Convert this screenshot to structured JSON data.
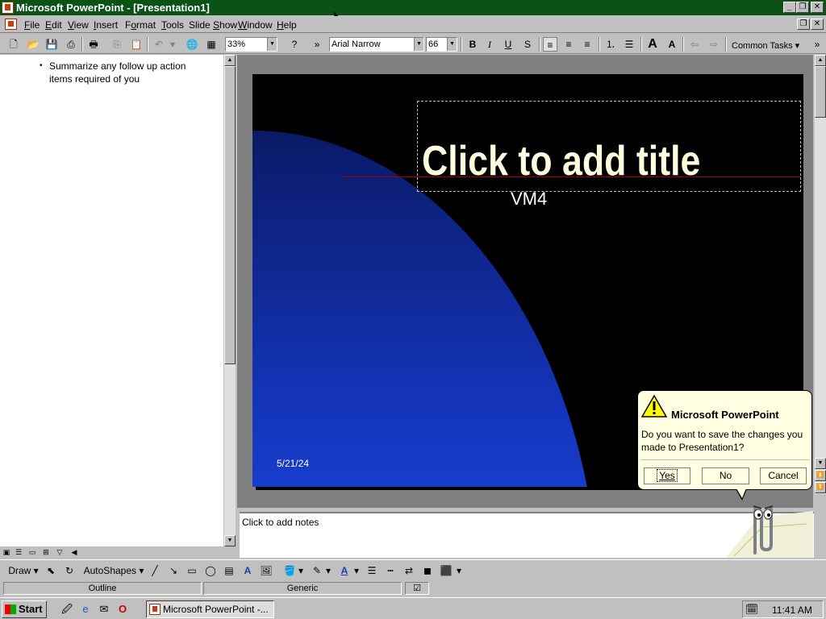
{
  "window": {
    "title": "Microsoft PowerPoint - [Presentation1]",
    "controls": [
      "_",
      "❐",
      "✕"
    ]
  },
  "menu": {
    "items": [
      {
        "pre": "",
        "ul": "F",
        "post": "ile"
      },
      {
        "pre": "",
        "ul": "E",
        "post": "dit"
      },
      {
        "pre": "",
        "ul": "V",
        "post": "iew"
      },
      {
        "pre": "",
        "ul": "I",
        "post": "nsert"
      },
      {
        "pre": "F",
        "ul": "o",
        "post": "rmat"
      },
      {
        "pre": "",
        "ul": "T",
        "post": "ools"
      },
      {
        "pre": "Slide ",
        "ul": "S",
        "post": "how"
      },
      {
        "pre": "",
        "ul": "W",
        "post": "indow"
      },
      {
        "pre": "",
        "ul": "H",
        "post": "elp"
      }
    ]
  },
  "toolbar": {
    "zoom": "33%",
    "font_name": "Arial Narrow",
    "font_size": "66",
    "common_tasks": "Common Tasks ▾",
    "bold": "B",
    "italic": "I",
    "underline": "U",
    "shadow": "S"
  },
  "outline": {
    "bullet": "•",
    "text": "Summarize any follow up action items required of you"
  },
  "slide": {
    "title": "Click to add title",
    "subtitle": "VM4",
    "date": "5/21/24"
  },
  "notes": {
    "placeholder": "Click to add notes"
  },
  "draw_toolbar": {
    "draw": "Draw ▾",
    "autoshapes": "AutoShapes ▾"
  },
  "statusbar": {
    "view": "Outline",
    "design": "Generic"
  },
  "taskbar": {
    "start": "Start",
    "task": "Microsoft PowerPoint -...",
    "time": "11:41 AM"
  },
  "dialog": {
    "title": "Microsoft PowerPoint",
    "message": "Do you want to save the changes you made to Presentation1?",
    "yes": "Yes",
    "no": "No",
    "cancel": "Cancel"
  },
  "colors": {
    "title_bar": "#0a5216",
    "slide_background": "#000000",
    "slide_title": "#ffffe0",
    "balloon": "#ffffe1"
  }
}
